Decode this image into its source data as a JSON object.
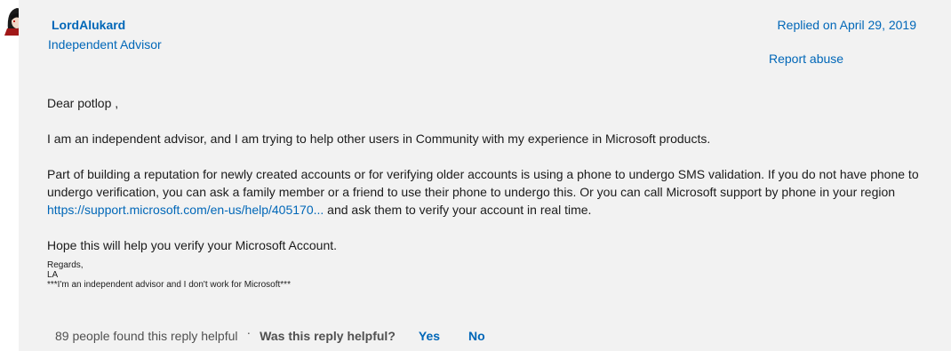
{
  "author": {
    "name": "LordAlukard",
    "role": "Independent Advisor"
  },
  "meta": {
    "replied": "Replied on April 29, 2019",
    "report_abuse": "Report abuse"
  },
  "body": {
    "greeting": "Dear potlop ,",
    "p1": "I am an independent advisor, and I am trying to help other users in Community with my experience in Microsoft products.",
    "p2_before": "Part of building a reputation for newly created accounts or for verifying older accounts is using a phone to undergo SMS validation. If you do not have phone to undergo verification, you can ask a family member or a friend to use their phone to undergo this. Or you can call Microsoft support by phone in your region ",
    "p2_link": "https://support.microsoft.com/en-us/help/405170...",
    "p2_after": " and ask them to verify your account in real time.",
    "p3": "Hope this will help you verify your Microsoft Account.",
    "sign_regards": "Regards,",
    "sign_name": "LA",
    "sign_disclaimer": "***I'm an independent advisor and I don't work for Microsoft***"
  },
  "footer": {
    "helpful_count": "89 people found this reply helpful",
    "separator": "·",
    "question": "Was this reply helpful?",
    "yes": "Yes",
    "no": "No"
  }
}
